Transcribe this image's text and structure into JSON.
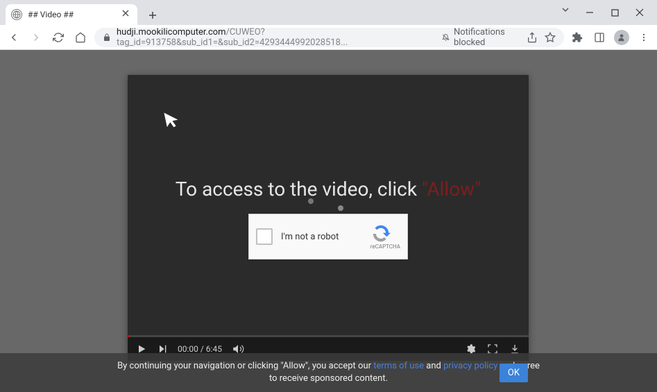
{
  "window": {
    "tab_title": "## Video ##"
  },
  "toolbar": {
    "url_host": "hudji.mookilicomputer.com",
    "url_path": "/CUWEO?tag_id=913758&sub_id1=&sub_id2=4293444992028518...",
    "notifications_label": "Notifications blocked"
  },
  "player": {
    "access_prefix": "To access to the video, click ",
    "access_allow": "\"Allow\"",
    "captcha_label": "I'm not a robot",
    "captcha_brand": "reCAPTCHA",
    "time_current": "00:00",
    "time_sep": " / ",
    "time_total": "6:45"
  },
  "consent": {
    "text_a": "By continuing your navigation or clicking \"Allow\", you accept our ",
    "link1": "terms of use",
    "text_b": " and ",
    "link2": "privacy policy",
    "text_c": " and agree to receive sponsored content.",
    "ok": "OK"
  }
}
